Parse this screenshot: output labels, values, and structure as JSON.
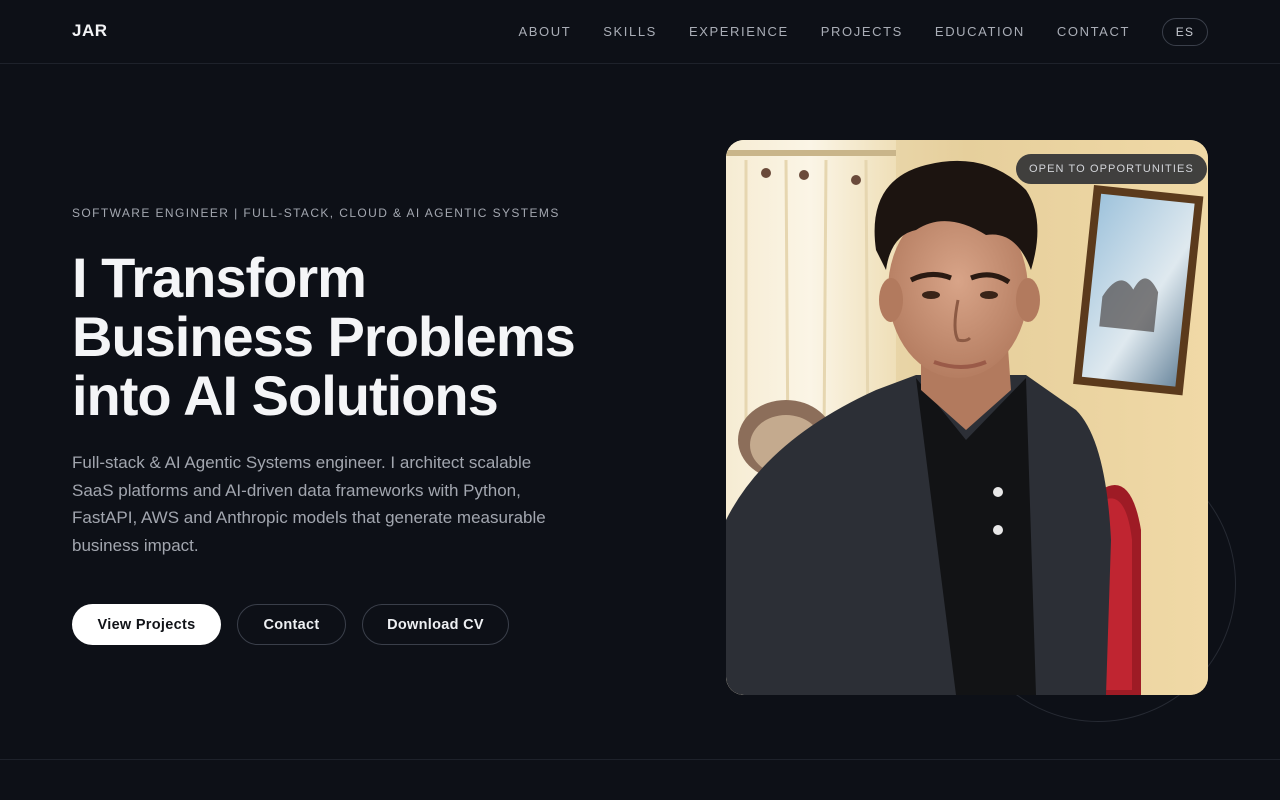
{
  "nav": {
    "logo": "JAR",
    "links": [
      "ABOUT",
      "SKILLS",
      "EXPERIENCE",
      "PROJECTS",
      "EDUCATION",
      "CONTACT"
    ],
    "language": "ES"
  },
  "hero": {
    "eyebrow": "SOFTWARE ENGINEER | FULL-STACK, CLOUD & AI AGENTIC SYSTEMS",
    "headline": "I Transform Business Problems into AI Solutions",
    "description": "Full-stack & AI Agentic Systems engineer. I architect scalable SaaS platforms and AI-driven data frameworks with Python, FastAPI, AWS and Anthropic models that generate measurable business impact.",
    "buttons": {
      "view_projects": "View Projects",
      "contact": "Contact",
      "download_cv": "Download CV"
    },
    "badge": "OPEN TO OPPORTUNITIES"
  },
  "colors": {
    "background": "#0d1017",
    "text_primary": "#f4f5f7",
    "text_muted": "#a2a6af",
    "button_primary_bg": "#ffffff"
  }
}
